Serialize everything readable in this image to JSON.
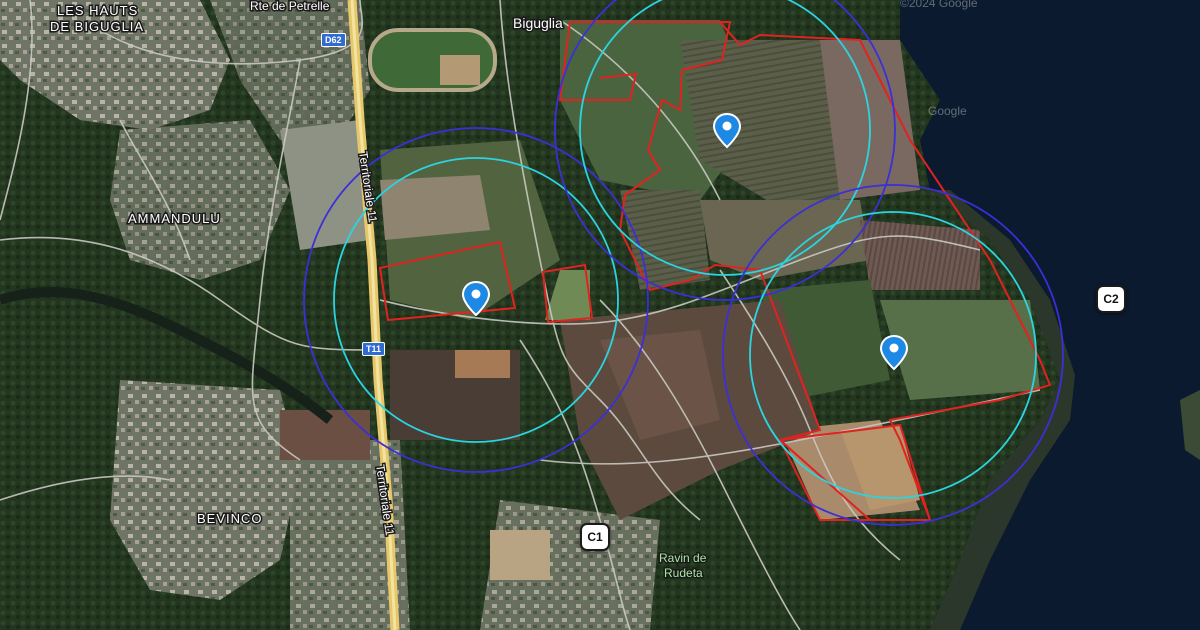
{
  "map": {
    "places": {
      "les_hauts_line1": "LES HAUTS",
      "les_hauts_line2": "DE BIGUGLIA",
      "ammandulu": "AMMANDULU",
      "bevinco": "BEVINCO",
      "biguglia": "Biguglia",
      "petrelle": "Rte de Petrelle",
      "ravin_line1": "Ravin de",
      "ravin_line2": "Rudeta"
    },
    "roads": {
      "territoriale_upper": "Territoriale 11",
      "territoriale_lower": "Territoriale 11",
      "d62": "D62",
      "t11": "T11"
    },
    "watermarks": {
      "google_top": "©2024 Google",
      "google_mid": "Google"
    },
    "badges": {
      "c1": "C1",
      "c2": "C2"
    },
    "colors": {
      "parcel_outline": "#e0231f",
      "inner_circle": "#2bd4e0",
      "outer_circle": "#3b2fd8",
      "pin": "#1e88e5",
      "sea": "#0b1a2e"
    },
    "markers": [
      {
        "name": "pin-west",
        "icon": "map-pin-icon"
      },
      {
        "name": "pin-north",
        "icon": "map-pin-icon"
      },
      {
        "name": "pin-south-east",
        "icon": "map-pin-icon"
      }
    ]
  }
}
